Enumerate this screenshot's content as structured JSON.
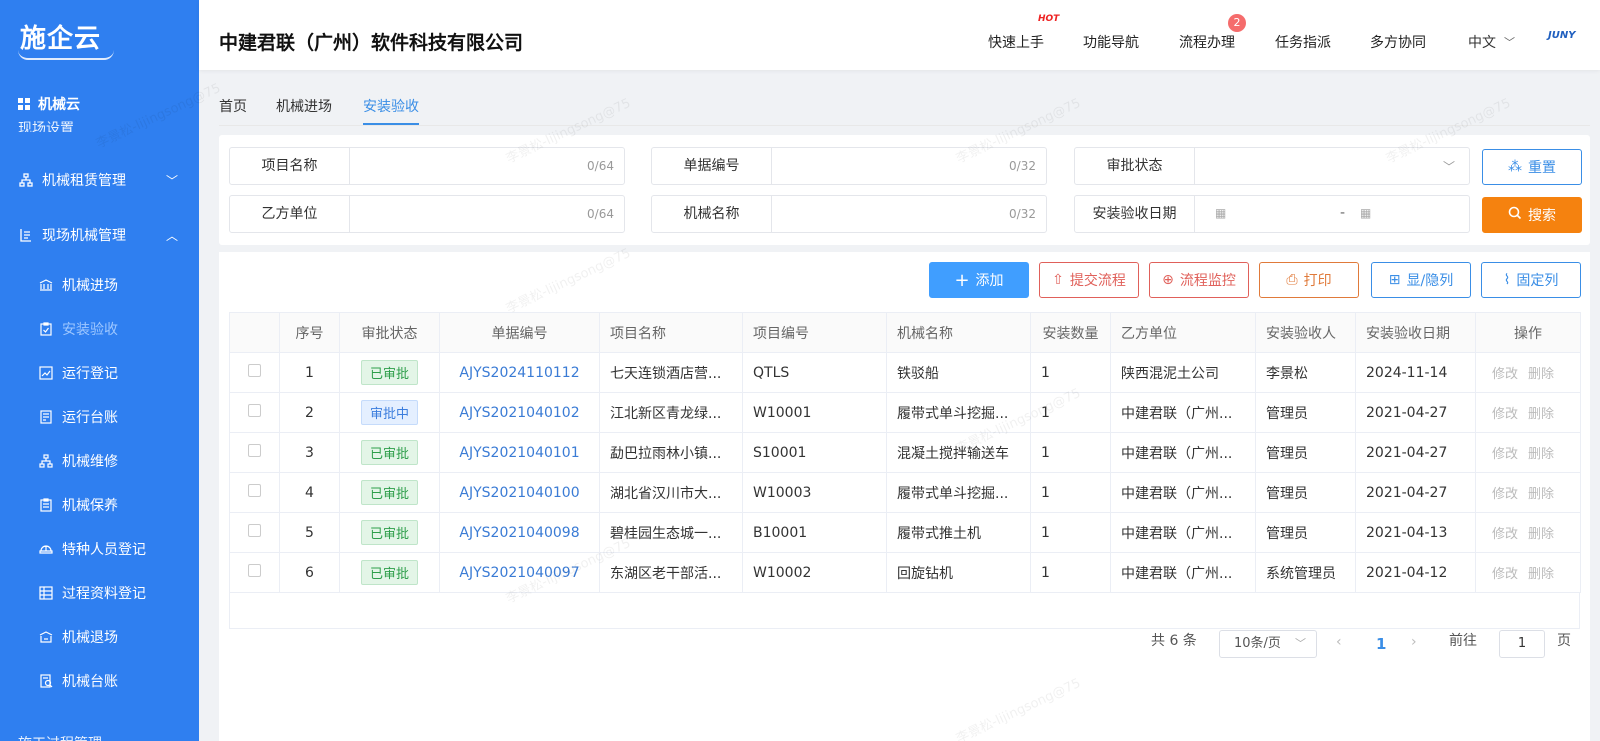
{
  "brand": {
    "logo": "施企云",
    "mini": "JUNY"
  },
  "sidebar": {
    "cloud_title": "机械云",
    "partial_item": "现场设置",
    "groups": [
      {
        "label": "机械租赁管理",
        "chevron": "﹀"
      },
      {
        "label": "现场机械管理",
        "chevron": "︿"
      }
    ],
    "items": [
      {
        "label": "机械进场"
      },
      {
        "label": "安装验收"
      },
      {
        "label": "运行登记"
      },
      {
        "label": "运行台账"
      },
      {
        "label": "机械维修"
      },
      {
        "label": "机械保养"
      },
      {
        "label": "特种人员登记"
      },
      {
        "label": "过程资料登记"
      },
      {
        "label": "机械退场"
      },
      {
        "label": "机械台账"
      }
    ],
    "bottom_partial": "施工过程管理"
  },
  "header": {
    "company": "中建君联（广州）软件科技有限公司",
    "nav": [
      "快速上手",
      "功能导航",
      "流程办理",
      "任务指派",
      "多方协同"
    ],
    "hot": "HOT",
    "badge": "2",
    "lang": "中文",
    "lang_chevron": "﹀"
  },
  "tabs": [
    "首页",
    "机械进场",
    "安装验收"
  ],
  "filters": {
    "project_name": {
      "label": "项目名称",
      "count": "0/64"
    },
    "doc_no": {
      "label": "单据编号",
      "count": "0/32"
    },
    "status": {
      "label": "审批状态",
      "chevron": "﹀"
    },
    "party_b": {
      "label": "乙方单位",
      "count": "0/64"
    },
    "machine_name": {
      "label": "机械名称",
      "count": "0/32"
    },
    "date": {
      "label": "安装验收日期",
      "separator": "-"
    }
  },
  "buttons": {
    "reset": "重置",
    "search": "搜索",
    "add": "添加",
    "submit_flow": "提交流程",
    "flow_monitor": "流程监控",
    "print": "打印",
    "toggle_cols": "显/隐列",
    "fix_cols": "固定列"
  },
  "table": {
    "columns": [
      "序号",
      "审批状态",
      "单据编号",
      "项目名称",
      "项目编号",
      "机械名称",
      "安装数量",
      "乙方单位",
      "安装验收人",
      "安装验收日期",
      "操作"
    ],
    "rows": [
      {
        "no": "1",
        "status": "已审批",
        "status_type": "ok",
        "doc": "AJYS2024110112",
        "project": "七天连锁酒店营...",
        "proj_no": "QTLS",
        "machine": "铁驳船",
        "qty": "1",
        "party": "陕西混泥土公司",
        "person": "李景松",
        "date": "2024-11-14",
        "edit": "修改",
        "del": "删除"
      },
      {
        "no": "2",
        "status": "审批中",
        "status_type": "ing",
        "doc": "AJYS2021040102",
        "project": "江北新区青龙绿...",
        "proj_no": "W10001",
        "machine": "履带式单斗挖掘...",
        "qty": "1",
        "party": "中建君联（广州...",
        "person": "管理员",
        "date": "2021-04-27",
        "edit": "修改",
        "del": "删除"
      },
      {
        "no": "3",
        "status": "已审批",
        "status_type": "ok",
        "doc": "AJYS2021040101",
        "project": "勐巴拉雨林小镇...",
        "proj_no": "S10001",
        "machine": "混凝土搅拌输送车",
        "qty": "1",
        "party": "中建君联（广州...",
        "person": "管理员",
        "date": "2021-04-27",
        "edit": "修改",
        "del": "删除"
      },
      {
        "no": "4",
        "status": "已审批",
        "status_type": "ok",
        "doc": "AJYS2021040100",
        "project": "湖北省汉川市大...",
        "proj_no": "W10003",
        "machine": "履带式单斗挖掘...",
        "qty": "1",
        "party": "中建君联（广州...",
        "person": "管理员",
        "date": "2021-04-27",
        "edit": "修改",
        "del": "删除"
      },
      {
        "no": "5",
        "status": "已审批",
        "status_type": "ok",
        "doc": "AJYS2021040098",
        "project": "碧桂园生态城一...",
        "proj_no": "B10001",
        "machine": "履带式推土机",
        "qty": "1",
        "party": "中建君联（广州...",
        "person": "管理员",
        "date": "2021-04-13",
        "edit": "修改",
        "del": "删除"
      },
      {
        "no": "6",
        "status": "已审批",
        "status_type": "ok",
        "doc": "AJYS2021040097",
        "project": "东湖区老干部活...",
        "proj_no": "W10002",
        "machine": "回旋钻机",
        "qty": "1",
        "party": "中建君联（广州...",
        "person": "系统管理员",
        "date": "2021-04-12",
        "edit": "修改",
        "del": "删除"
      }
    ]
  },
  "pagination": {
    "total": "共 6 条",
    "page_size": "10条/页",
    "current": "1",
    "prev": "‹",
    "next": "›",
    "goto_label": "前往",
    "goto_value": "1",
    "page_unit": "页"
  },
  "watermark": {
    "name": "李景松-lijingsong@75",
    "company": "中建君联"
  },
  "colors": {
    "sidebar": "#2f7ff0",
    "primary": "#409eff",
    "search": "#f5820f",
    "danger": "#e0605a"
  }
}
